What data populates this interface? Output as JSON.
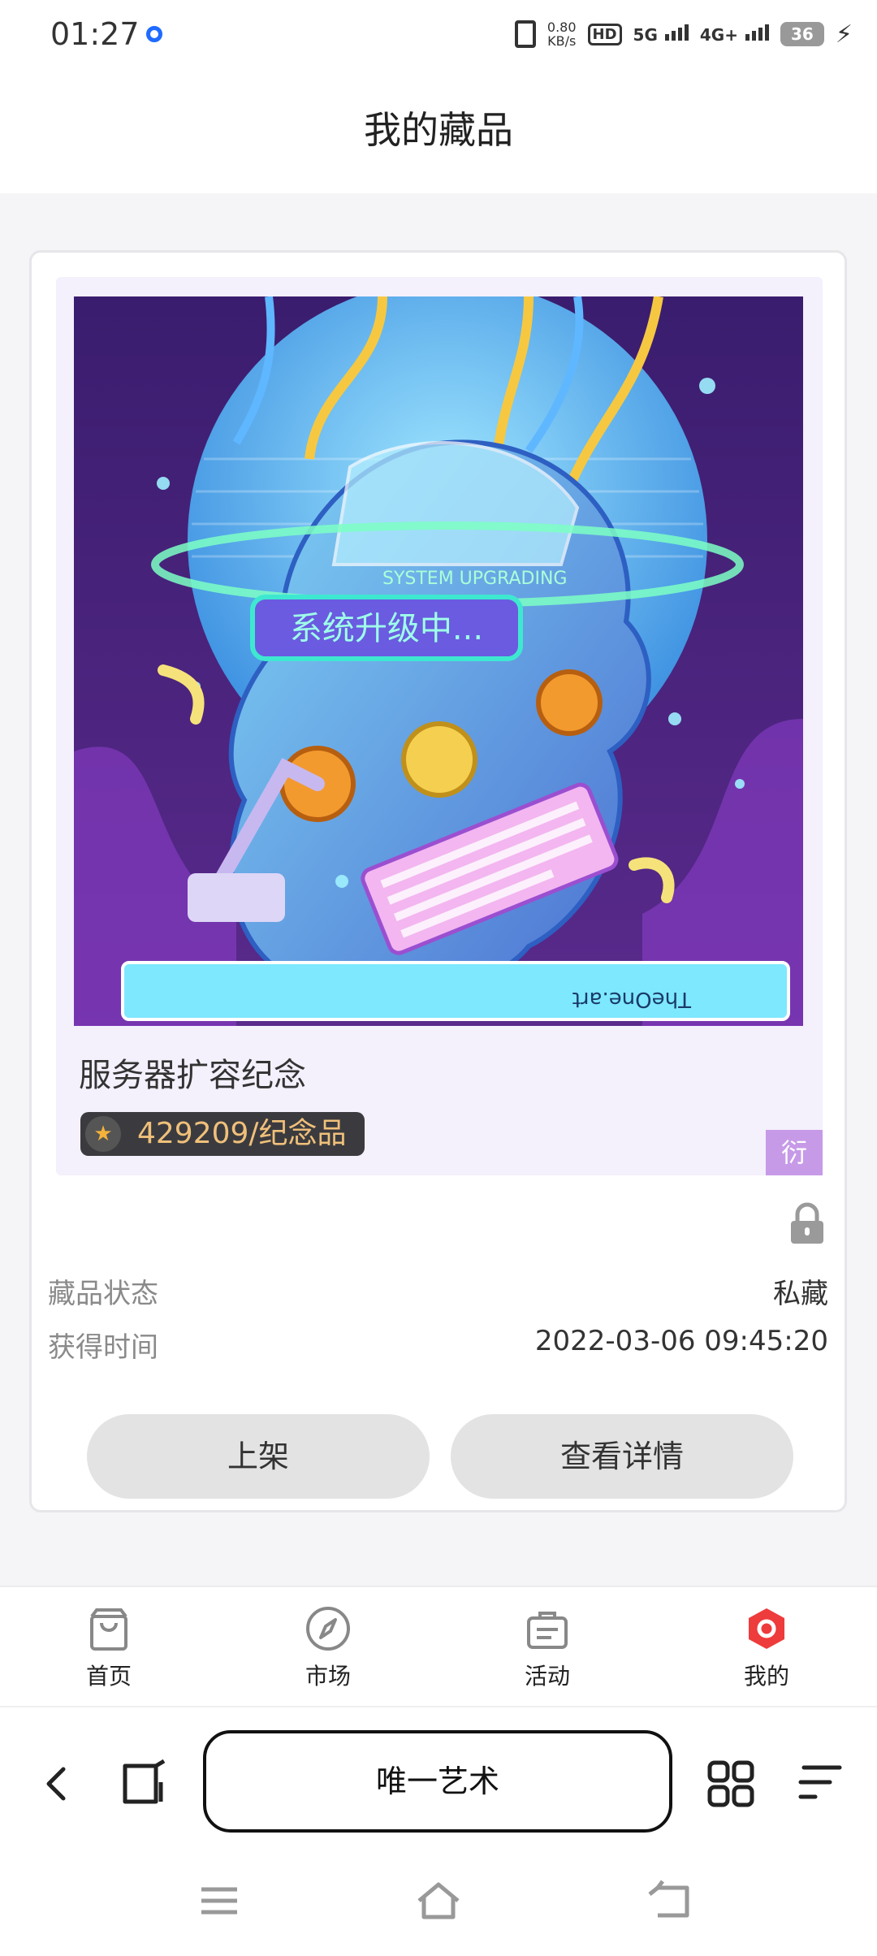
{
  "status_bar": {
    "time": "01:27",
    "net_speed_value": "0.80",
    "net_speed_unit": "KB/s",
    "hd_label": "HD",
    "network_1": "5G",
    "network_2": "4G+",
    "battery": "36"
  },
  "header": {
    "title": "我的藏品"
  },
  "collectible": {
    "name": "服务器扩容纪念",
    "serial": "429209/纪念品",
    "corner_tag": "衍",
    "artwork": {
      "banner_text": "系统升级中...",
      "ring_text": "SYSTEM UPGRADING",
      "signature": "TheOne.art"
    },
    "status_label": "藏品状态",
    "status_value": "私藏",
    "time_label": "获得时间",
    "time_value": "2022-03-06 09:45:20",
    "list_button": "上架",
    "detail_button": "查看详情"
  },
  "tabbar": {
    "tabs": [
      {
        "label": "首页"
      },
      {
        "label": "市场"
      },
      {
        "label": "活动"
      },
      {
        "label": "我的"
      }
    ],
    "active_color": "#ee3b3b"
  },
  "browser": {
    "site_title": "唯一艺术"
  }
}
